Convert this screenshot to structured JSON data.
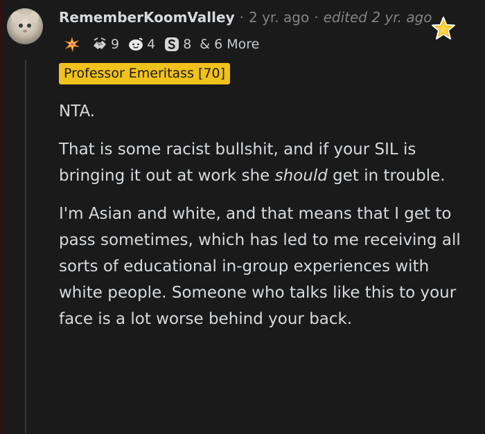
{
  "comment": {
    "username": "RememberKoomValley",
    "age": "2 yr. ago",
    "edited": "edited 2 yr. ago",
    "separator": "·",
    "awards": [
      {
        "icon": "sparkle-burst-icon",
        "count": ""
      },
      {
        "icon": "handshake-icon",
        "count": "9"
      },
      {
        "icon": "wholesome-face-icon",
        "count": "4"
      },
      {
        "icon": "silver-coin-icon",
        "count": "8"
      }
    ],
    "more_awards": "& 6 More",
    "star_award_icon": "star-award-icon",
    "flair": "Professor Emeritass [70]",
    "flair_color": "#f1c21b",
    "body": {
      "p1": "NTA.",
      "p2_before": "That is some racist bullshit, and if your SIL is bringing it out at work she ",
      "p2_emphasis": "should",
      "p2_after": " get in trouble.",
      "p3": "I'm Asian and white, and that means that I get to pass sometimes, which has led to me receiving all sorts of educational in-group experiences with white people. Someone who talks like this to your face is a lot worse behind your back."
    }
  }
}
